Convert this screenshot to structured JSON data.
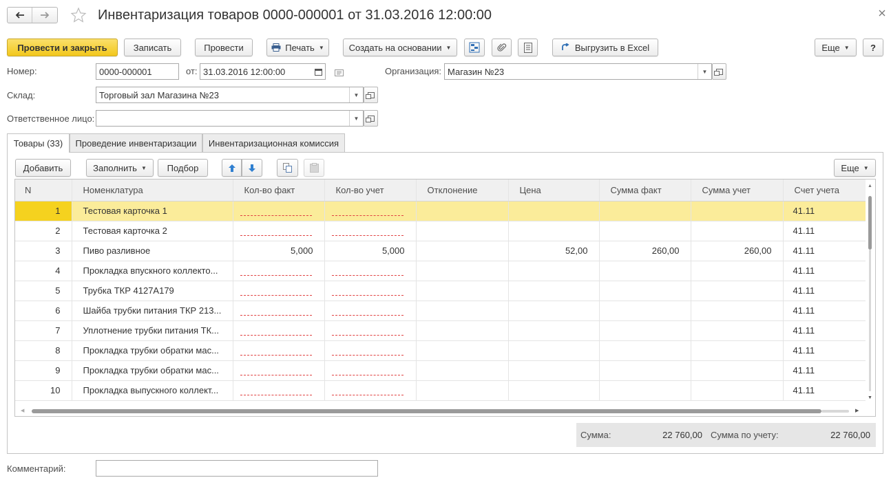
{
  "window": {
    "title": "Инвентаризация товаров 0000-000001 от 31.03.2016 12:00:00"
  },
  "toolbar": {
    "post_close": "Провести и закрыть",
    "save": "Записать",
    "post": "Провести",
    "print": "Печать",
    "create_based": "Создать на основании",
    "export_excel": "Выгрузить в Excel",
    "more": "Еще",
    "help": "?"
  },
  "form": {
    "number_label": "Номер:",
    "number_value": "0000-000001",
    "date_label": "от:",
    "date_value": "31.03.2016 12:00:00",
    "org_label": "Организация:",
    "org_value": "Магазин №23",
    "warehouse_label": "Склад:",
    "warehouse_value": "Торговый зал Магазина №23",
    "responsible_label": "Ответственное лицо:",
    "responsible_value": "",
    "comment_label": "Комментарий:",
    "comment_value": ""
  },
  "tabs": [
    {
      "label": "Товары (33)"
    },
    {
      "label": "Проведение инвентаризации"
    },
    {
      "label": "Инвентаризационная комиссия"
    }
  ],
  "table_toolbar": {
    "add": "Добавить",
    "fill": "Заполнить",
    "pick": "Подбор",
    "more": "Еще"
  },
  "table": {
    "columns": [
      "N",
      "Номенклатура",
      "Кол-во факт",
      "Кол-во учет",
      "Отклонение",
      "Цена",
      "Сумма факт",
      "Сумма учет",
      "Счет учета"
    ],
    "rows": [
      {
        "n": "1",
        "name": "Тестовая карточка 1",
        "qty_fact": "",
        "qty_acc": "",
        "dev": "",
        "price": "",
        "sum_fact": "",
        "sum_acc": "",
        "account": "41.11"
      },
      {
        "n": "2",
        "name": "Тестовая карточка 2",
        "qty_fact": "",
        "qty_acc": "",
        "dev": "",
        "price": "",
        "sum_fact": "",
        "sum_acc": "",
        "account": "41.11"
      },
      {
        "n": "3",
        "name": "Пиво разливное",
        "qty_fact": "5,000",
        "qty_acc": "5,000",
        "dev": "",
        "price": "52,00",
        "sum_fact": "260,00",
        "sum_acc": "260,00",
        "account": "41.11"
      },
      {
        "n": "4",
        "name": "Прокладка впускного коллекто...",
        "qty_fact": "",
        "qty_acc": "",
        "dev": "",
        "price": "",
        "sum_fact": "",
        "sum_acc": "",
        "account": "41.11"
      },
      {
        "n": "5",
        "name": "Трубка ТКР 4127А179",
        "qty_fact": "",
        "qty_acc": "",
        "dev": "",
        "price": "",
        "sum_fact": "",
        "sum_acc": "",
        "account": "41.11"
      },
      {
        "n": "6",
        "name": "Шайба трубки питания ТКР 213...",
        "qty_fact": "",
        "qty_acc": "",
        "dev": "",
        "price": "",
        "sum_fact": "",
        "sum_acc": "",
        "account": "41.11"
      },
      {
        "n": "7",
        "name": "Уплотнение трубки питания ТК...",
        "qty_fact": "",
        "qty_acc": "",
        "dev": "",
        "price": "",
        "sum_fact": "",
        "sum_acc": "",
        "account": "41.11"
      },
      {
        "n": "8",
        "name": "Прокладка трубки обратки мас...",
        "qty_fact": "",
        "qty_acc": "",
        "dev": "",
        "price": "",
        "sum_fact": "",
        "sum_acc": "",
        "account": "41.11"
      },
      {
        "n": "9",
        "name": "Прокладка трубки обратки мас...",
        "qty_fact": "",
        "qty_acc": "",
        "dev": "",
        "price": "",
        "sum_fact": "",
        "sum_acc": "",
        "account": "41.11"
      },
      {
        "n": "10",
        "name": "Прокладка выпускного коллект...",
        "qty_fact": "",
        "qty_acc": "",
        "dev": "",
        "price": "",
        "sum_fact": "",
        "sum_acc": "",
        "account": "41.11"
      }
    ]
  },
  "totals": {
    "sum_label": "Сумма:",
    "sum_value": "22 760,00",
    "sum_acc_label": "Сумма по учету:",
    "sum_acc_value": "22 760,00"
  },
  "colors": {
    "primary_button": "#f2c71c",
    "selected_row": "#fbec9a",
    "selected_cell": "#f5d21f",
    "required_underline": "#e04040"
  },
  "icons": [
    "back-icon",
    "forward-icon",
    "favorite-star-icon",
    "close-icon",
    "printer-icon",
    "structure-icon",
    "attachment-icon",
    "document-list-icon",
    "export-arrow-icon",
    "calendar-icon",
    "history-icon",
    "move-up-icon",
    "move-down-icon",
    "copy-icon",
    "paste-icon"
  ]
}
